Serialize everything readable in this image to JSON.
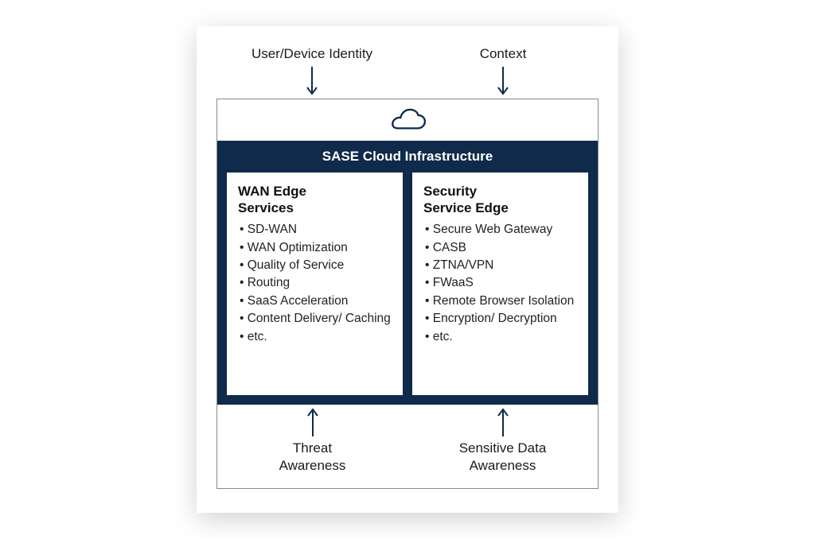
{
  "colors": {
    "navy": "#0f2a4a",
    "stroke": "#0f2a4a"
  },
  "top_inputs": {
    "left": "User/Device Identity",
    "right": "Context"
  },
  "sase": {
    "title": "SASE Cloud Infrastructure",
    "left_col": {
      "title_line1": "WAN Edge",
      "title_line2": "Services",
      "items": [
        "SD-WAN",
        "WAN Optimization",
        "Quality of Service",
        "Routing",
        "SaaS Acceleration",
        "Content Delivery/ Caching",
        "etc."
      ]
    },
    "right_col": {
      "title_line1": "Security",
      "title_line2": "Service Edge",
      "items": [
        "Secure Web Gateway",
        "CASB",
        "ZTNA/VPN",
        "FWaaS",
        "Remote Browser Isolation",
        "Encryption/ Decryption",
        "etc."
      ]
    }
  },
  "bottom_inputs": {
    "left_line1": "Threat",
    "left_line2": "Awareness",
    "right_line1": "Sensitive Data",
    "right_line2": "Awareness"
  }
}
